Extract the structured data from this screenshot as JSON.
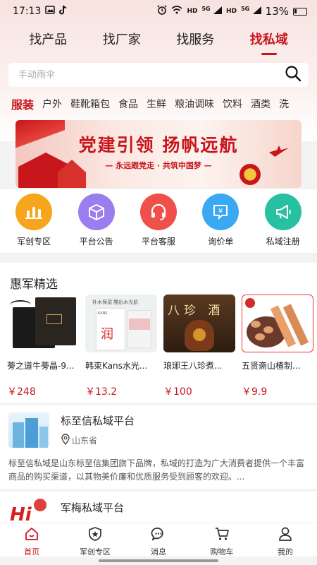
{
  "status_bar": {
    "time": "17:13",
    "network_hd1": "HD",
    "network_5g1": "5G",
    "network_hd2": "HD",
    "network_5g2": "5G",
    "battery": "13%"
  },
  "top_tabs": [
    {
      "label": "找产品",
      "active": false
    },
    {
      "label": "找厂家",
      "active": false
    },
    {
      "label": "找服务",
      "active": false
    },
    {
      "label": "找私域",
      "active": true
    }
  ],
  "search": {
    "placeholder": "手动雨伞",
    "icon": "search-icon"
  },
  "categories": [
    "服装",
    "户外",
    "鞋靴箱包",
    "食品",
    "生鲜",
    "粮油调味",
    "饮料",
    "酒类",
    "洗"
  ],
  "banner": {
    "title": "党建引领  扬帆远航",
    "subtitle": "— 永远跟党走 · 共筑中国梦 —"
  },
  "quick_links": [
    {
      "label": "军创专区",
      "icon": "bar-chart-icon",
      "color": "#f7a51c"
    },
    {
      "label": "平台公告",
      "icon": "box-icon",
      "color": "#9b7df0"
    },
    {
      "label": "平台客服",
      "icon": "headset-icon",
      "color": "#f0504a"
    },
    {
      "label": "询价单",
      "icon": "yen-document-icon",
      "color": "#3aa8f2"
    },
    {
      "label": "私域注册",
      "icon": "megaphone-icon",
      "color": "#27c0a0"
    }
  ],
  "featured": {
    "title": "惠军精选",
    "products": [
      {
        "name": "蒡之道牛蒡晶-9...",
        "price": "￥248"
      },
      {
        "name": "韩束Kans水光...",
        "price": "￥13.2",
        "img_text_top": "补水保湿 酷出水光肌",
        "img_text_brand": "KANS",
        "img_text_char": "润"
      },
      {
        "name": "琅琊王八珍煮...",
        "price": "￥100",
        "img_text": "八珍 酒"
      },
      {
        "name": "五贤斋山楂制...",
        "price": "￥9.9"
      }
    ]
  },
  "shops": [
    {
      "name": "标至信私域平台",
      "location": "山东省",
      "description": "标至信私域是山东标至信集团旗下品牌，私域的打造为广大消费者提供一个丰富商品的购买渠道，以其物美价廉和优质服务受到顾客的欢迎。..."
    },
    {
      "name": "军梅私域平台",
      "logo_text": "Hi"
    }
  ],
  "bottom_nav": [
    {
      "label": "首页",
      "icon": "home-icon",
      "active": true
    },
    {
      "label": "军创专区",
      "icon": "shield-star-icon",
      "active": false
    },
    {
      "label": "消息",
      "icon": "message-icon",
      "active": false
    },
    {
      "label": "购物车",
      "icon": "cart-icon",
      "active": false
    },
    {
      "label": "我的",
      "icon": "user-icon",
      "active": false
    }
  ],
  "colors": {
    "accent": "#c8161d",
    "price": "#c8161d"
  }
}
